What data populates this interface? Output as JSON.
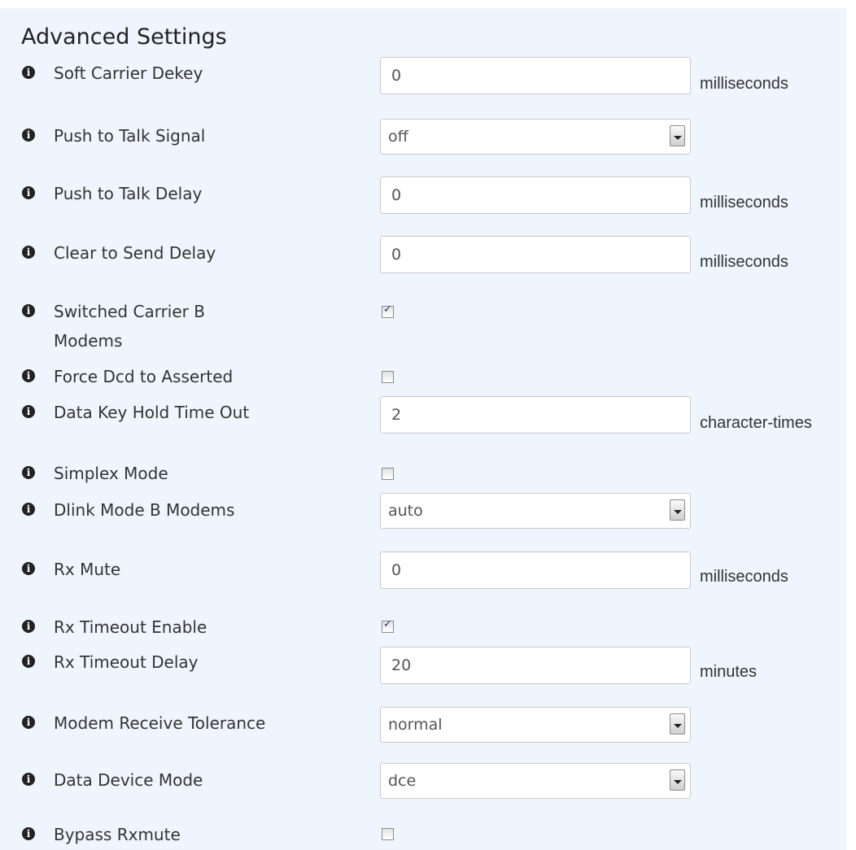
{
  "section": {
    "title": "Advanced Settings"
  },
  "fields": {
    "soft_carrier_dekey": {
      "label": "Soft Carrier Dekey",
      "value": "0",
      "unit": "milliseconds"
    },
    "push_to_talk_signal": {
      "label": "Push to Talk Signal",
      "value": "off"
    },
    "push_to_talk_delay": {
      "label": "Push to Talk Delay",
      "value": "0",
      "unit": "milliseconds"
    },
    "clear_to_send_delay": {
      "label": "Clear to Send Delay",
      "value": "0",
      "unit": "milliseconds"
    },
    "switched_carrier_b_modems": {
      "label_line1": "Switched Carrier B",
      "label_line2": "Modems",
      "checked": true
    },
    "force_dcd_to_asserted": {
      "label": "Force Dcd to Asserted",
      "checked": false
    },
    "data_key_hold_time_out": {
      "label": "Data Key Hold Time Out",
      "value": "2",
      "unit": "character-times"
    },
    "simplex_mode": {
      "label": "Simplex Mode",
      "checked": false
    },
    "dlink_mode_b_modems": {
      "label": "Dlink Mode B Modems",
      "value": "auto"
    },
    "rx_mute": {
      "label": "Rx Mute",
      "value": "0",
      "unit": "milliseconds"
    },
    "rx_timeout_enable": {
      "label": "Rx Timeout Enable",
      "checked": true
    },
    "rx_timeout_delay": {
      "label": "Rx Timeout Delay",
      "value": "20",
      "unit": "minutes"
    },
    "modem_receive_tolerance": {
      "label": "Modem Receive Tolerance",
      "value": "normal"
    },
    "data_device_mode": {
      "label": "Data Device Mode",
      "value": "dce"
    },
    "bypass_rxmute": {
      "label": "Bypass Rxmute",
      "checked": false
    }
  },
  "icons": {
    "info": "info-icon",
    "info_glyph": "i",
    "check_glyph": "✓"
  },
  "colors": {
    "panel_background": "#eef5fc",
    "checkmark": "#2a2a8a"
  }
}
